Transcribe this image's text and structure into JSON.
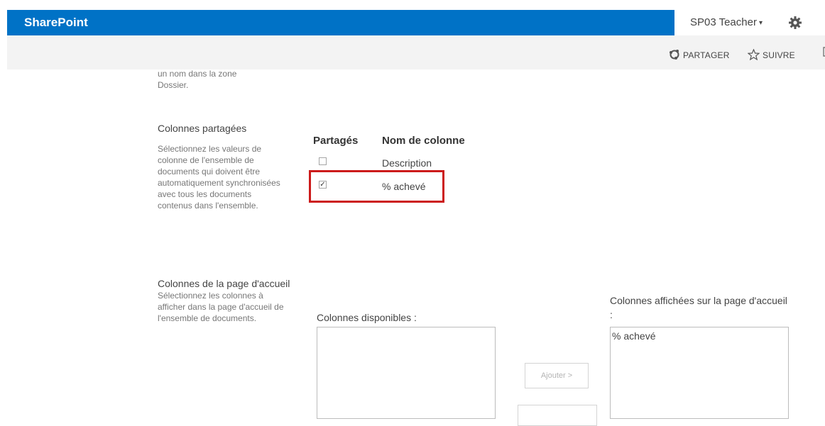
{
  "suite_bar": {
    "brand": "SharePoint",
    "user_name": "SP03 Teacher",
    "user_caret": "▾",
    "settings_icon": "gear-icon",
    "brand_color": "#0072c6"
  },
  "ribbon": {
    "share_label": "PARTAGER",
    "follow_label": "SUIVRE",
    "share_icon": "share-icon",
    "follow_icon": "star-icon"
  },
  "intro_cut_text": "un nom dans la zone\nDossier.",
  "shared_columns": {
    "title": "Colonnes partagées",
    "description": "Sélectionnez les valeurs de colonne de l'ensemble de documents qui doivent être automatiquement synchronisées avec tous les documents contenus dans l'ensemble.",
    "header_shared": "Partagés",
    "header_name": "Nom de colonne",
    "rows": [
      {
        "name": "Description",
        "checked": false
      },
      {
        "name": "% achevé",
        "checked": true
      }
    ],
    "highlight_color": "#cc1b1b"
  },
  "welcome_columns": {
    "title": "Colonnes de la page d'accueil",
    "description": "Sélectionnez les colonnes à afficher dans la page d'accueil de l'ensemble de documents.",
    "available_label": "Colonnes disponibles :",
    "available_items": [],
    "displayed_label": "Colonnes affichées sur la page d'accueil :",
    "displayed_items": [
      "% achevé"
    ],
    "add_button": "Ajouter >"
  }
}
